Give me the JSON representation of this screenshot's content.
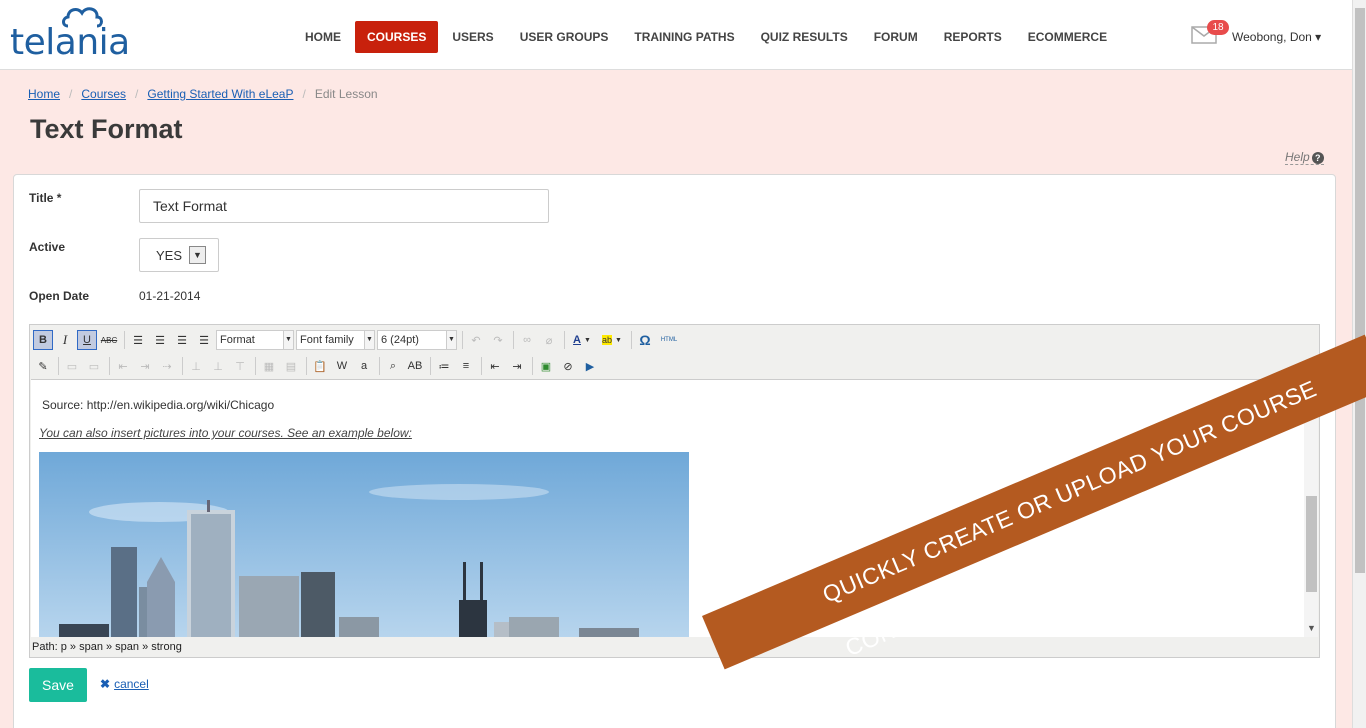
{
  "header": {
    "logo_text": "telania",
    "nav": [
      "HOME",
      "COURSES",
      "USERS",
      "USER GROUPS",
      "TRAINING PATHS",
      "QUIZ RESULTS",
      "FORUM",
      "REPORTS",
      "ECOMMERCE"
    ],
    "active_nav": "COURSES",
    "mail_count": "18",
    "user_name": "Weobong, Don ▾"
  },
  "breadcrumb": {
    "items": [
      "Home",
      "Courses",
      "Getting Started With eLeaP"
    ],
    "current": "Edit Lesson",
    "separator": "/"
  },
  "page": {
    "title": "Text Format",
    "help_label": "Help"
  },
  "form": {
    "title_label": "Title *",
    "title_value": "Text Format",
    "active_label": "Active",
    "active_value": "YES",
    "open_date_label": "Open Date",
    "open_date_value": "01-21-2014"
  },
  "editor": {
    "format_label": "Format",
    "font_family_label": "Font family",
    "font_size_label": "6 (24pt)",
    "html_label": "HTML",
    "source_line": "Source: http://en.wikipedia.org/wiki/Chicago",
    "insert_text": "You can also insert pictures into your courses. See an example below:",
    "path": "Path: p » span » span » strong"
  },
  "actions": {
    "save_label": "Save",
    "cancel_label": "cancel"
  },
  "promo": {
    "text": "QUICKLY CREATE OR UPLOAD YOUR COURSE CONTENT"
  },
  "colors": {
    "brand_blue": "#1f5fa0",
    "active_nav": "#c8210c",
    "save_green": "#1abc9c",
    "ribbon": "#b45a20",
    "page_bg": "#fde8e5"
  }
}
